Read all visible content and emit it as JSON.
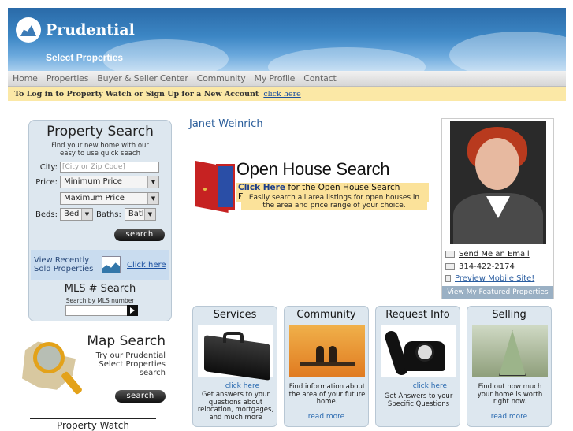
{
  "header": {
    "brand": "Prudential",
    "sub_brand": "Select Properties"
  },
  "nav": {
    "items": [
      "Home",
      "Properties",
      "Buyer & Seller Center",
      "Community",
      "My Profile",
      "Contact"
    ]
  },
  "login_bar": {
    "text": "To Log in to Property Watch or Sign Up for a New Account",
    "link": "click here"
  },
  "property_search": {
    "title": "Property Search",
    "subtitle_1": "Find your new home with our",
    "subtitle_2": "easy to use quick seach",
    "city_label": "City:",
    "city_placeholder": "[City or Zip Code]",
    "price_label": "Price:",
    "min_price": "Minimum Price",
    "max_price": "Maximum Price",
    "beds_label": "Beds:",
    "beds_value": "Bed",
    "baths_label": "Baths:",
    "baths_value": "Batl",
    "search_button": "search",
    "sold_text_1": "View Recently",
    "sold_text_2": "Sold Properties",
    "sold_link": "Click here",
    "mls_title": "MLS # Search",
    "mls_sub": "Search by MLS number"
  },
  "map_search": {
    "title": "Map Search",
    "sub_1": "Try our Prudential",
    "sub_2": "Select Properties",
    "sub_3": "search",
    "button": "search"
  },
  "property_watch": {
    "title": "Property Watch"
  },
  "agent": {
    "name": "Janet Weinrich",
    "email_link": "Send Me an Email",
    "phone": "314-422-2174",
    "mobile_link": "Preview Mobile Site!",
    "featured_link": "View My Featured Properties"
  },
  "open_house": {
    "title": "Open House Search",
    "click_here": "Click Here",
    "click_rest": "for the Open House Search Engine.",
    "desc_1": "Easily search all area listings for open houses in",
    "desc_2": "the area and price range of your choice."
  },
  "tiles": [
    {
      "title": "Services",
      "more": "click here",
      "desc": "Get answers to your questions about relocation, mortgages, and much more"
    },
    {
      "title": "Community",
      "more": "read more",
      "desc": "Find information about the area of your future home."
    },
    {
      "title": "Request Info",
      "more": "click here",
      "desc": "Get Answers to your Specific Questions"
    },
    {
      "title": "Selling",
      "more": "read more",
      "desc": "Find out how much your home is worth right now."
    }
  ]
}
